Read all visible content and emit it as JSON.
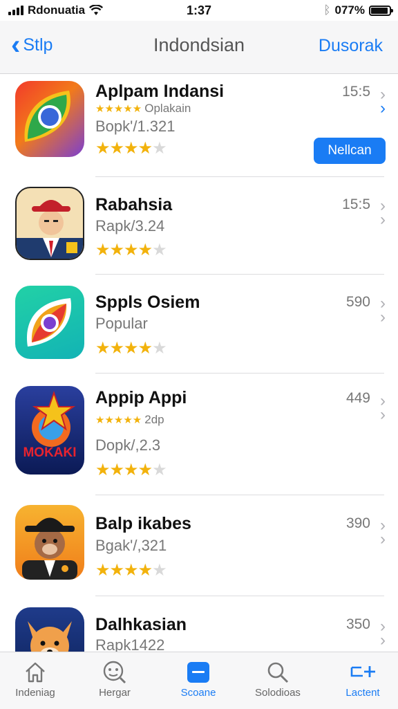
{
  "status_bar": {
    "carrier": "Rdonuatia",
    "time": "1:37",
    "battery": "077%"
  },
  "nav": {
    "back_label": "Stlp",
    "title": "Indondsian",
    "right_label": "Dusorak"
  },
  "apps": [
    {
      "title": "Aplpam Indansi",
      "meta_label": "Oplakain",
      "sub": "Bopk'/1.321",
      "size": "15:5",
      "button": "Nellcan"
    },
    {
      "title": "Rabahsia",
      "sub": "Rapk/3.24",
      "size": "15:5"
    },
    {
      "title": "Sppls Osiem",
      "sub": "Popular",
      "size": "590"
    },
    {
      "title": "Appip Appi",
      "meta_label": "2dp",
      "sub": "Dopk/,2.3",
      "size": "449"
    },
    {
      "title": "Balp ikabes",
      "sub": "Bgak'/,321",
      "size": "390"
    },
    {
      "title": "Dalhkasian",
      "sub": "Rapk1422",
      "size": "350"
    }
  ],
  "icon_text": {
    "mokaki": "MOKAKI"
  },
  "stars": "★★★★",
  "small_stars": "★★★★★",
  "tabs": [
    {
      "label": "Indeniag",
      "icon": "home-icon"
    },
    {
      "label": "Hergar",
      "icon": "face-search-icon"
    },
    {
      "label": "Scoane",
      "icon": "card-icon"
    },
    {
      "label": "Solodioas",
      "icon": "search-icon"
    },
    {
      "label": "Lactent",
      "icon": "add-icon"
    }
  ],
  "colors": {
    "accent": "#1a7cf4",
    "star": "#f2b20c"
  }
}
